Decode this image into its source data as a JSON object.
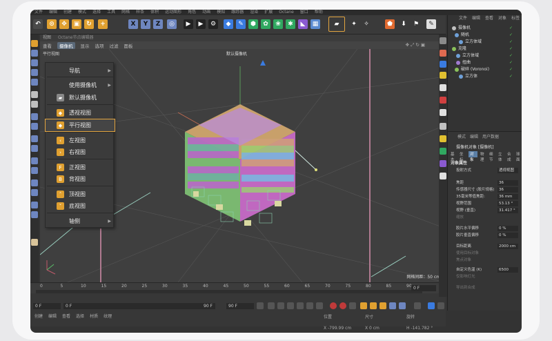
{
  "menubar": [
    "文件",
    "编辑",
    "创建",
    "模式",
    "选择",
    "工具",
    "网格",
    "样条",
    "体积",
    "运动图形",
    "角色",
    "动画",
    "模拟",
    "跟踪器",
    "渲染",
    "扩展",
    "Octane",
    "窗口",
    "帮助"
  ],
  "viewport_header": {
    "title": "视图",
    "hint": "Octane节点编辑器"
  },
  "viewport_menu": {
    "items": [
      "查看",
      "摄像机",
      "显示",
      "选项",
      "过滤",
      "面板"
    ],
    "active": "摄像机"
  },
  "viewport": {
    "mode_label": "平行视图",
    "camera_label": "默认摄像机",
    "grid_label": "网格间距：50 cm"
  },
  "camera_menu": {
    "items": [
      {
        "label": "导航",
        "icon": "",
        "submenu": true
      },
      {
        "label": "使用摄像机",
        "icon": "",
        "submenu": true
      },
      {
        "label": "默认摄像机",
        "icon": "camera-icon",
        "submenu": false
      },
      {
        "label": "透视视图",
        "icon": "perspective-cube-icon",
        "submenu": false
      },
      {
        "label": "平行视图",
        "icon": "parallel-cube-icon",
        "submenu": false
      },
      {
        "label": "左视图",
        "icon": "left-arrow-icon",
        "submenu": false
      },
      {
        "label": "右视图",
        "icon": "right-arrow-icon",
        "submenu": false
      },
      {
        "label": "正视图",
        "icon": "front-f-icon",
        "submenu": false
      },
      {
        "label": "背视图",
        "icon": "back-b-icon",
        "submenu": false
      },
      {
        "label": "顶视图",
        "icon": "top-arrow-icon",
        "submenu": false
      },
      {
        "label": "底视图",
        "icon": "bottom-arrow-icon",
        "submenu": false
      },
      {
        "label": "轴侧",
        "icon": "",
        "submenu": true
      }
    ],
    "highlighted": "平行视图"
  },
  "timeline": {
    "ticks": [
      "0",
      "5",
      "10",
      "15",
      "20",
      "25",
      "30",
      "35",
      "40",
      "45",
      "50",
      "55",
      "60",
      "65",
      "70",
      "75",
      "80",
      "85",
      "90"
    ],
    "current_frame": "0 F"
  },
  "playback": {
    "start": "0 F",
    "range_start": "0 F",
    "range_end": "90 F",
    "end": "90 F"
  },
  "bottom_menu": [
    "创建",
    "编辑",
    "查看",
    "选择",
    "材质",
    "纹理"
  ],
  "coords": {
    "position_label": "位置",
    "size_label": "尺寸",
    "rotation_label": "旋转",
    "x_pos": "X  -799.99 cm",
    "x_size": "X  0 cm",
    "h_rot": "H  -141.782 °"
  },
  "object_panel": {
    "menu": [
      "文件",
      "编辑",
      "查看",
      "对象",
      "标签"
    ],
    "rows": [
      {
        "label": "摄像机",
        "color": "#d0d0d0",
        "dot": "#c0c0c0"
      },
      {
        "label": "随机",
        "color": "#d0d0d0",
        "dot": "#6fa0d8"
      },
      {
        "label": "立方体域",
        "color": "#d0d0d0",
        "dot": "#6fa0d8"
      },
      {
        "label": "克隆",
        "color": "#d0d0d0",
        "dot": "#8ac05a"
      },
      {
        "label": "立方体域",
        "color": "#d0d0d0",
        "dot": "#6fa0d8"
      },
      {
        "label": "扭曲",
        "color": "#d0d0d0",
        "dot": "#a07ad0"
      },
      {
        "label": "破碎 (Voronoi)",
        "color": "#d0d0d0",
        "dot": "#8ac05a"
      },
      {
        "label": "立方体",
        "color": "#d0d0d0",
        "dot": "#6fa0d8"
      }
    ]
  },
  "attributes": {
    "menu": [
      "模式",
      "编辑",
      "用户数据"
    ],
    "title": "摄像机对象 [摄像机]",
    "tabs": [
      "基本",
      "坐标",
      "对象",
      "物理",
      "细节",
      "立体",
      "合成",
      "球面"
    ],
    "active_tab": "对象",
    "section": "对象属性",
    "rows": [
      {
        "label": "投射方式",
        "value": "透视视图"
      },
      {
        "label": "焦距",
        "value": "36"
      },
      {
        "label": "传感器尺寸 (胶片规格)",
        "value": "36"
      },
      {
        "label": "35毫米等值焦距:",
        "value": "36 mm"
      },
      {
        "label": "视野范围",
        "value": "53.13 °"
      },
      {
        "label": "视野 (垂直)",
        "value": "31.417 °"
      },
      {
        "label": "缩放",
        "value": ""
      },
      {
        "label": "胶片水平偏移",
        "value": "0 %"
      },
      {
        "label": "胶片垂直偏移",
        "value": "0 %"
      },
      {
        "label": "目标距离",
        "value": "2000 cm"
      },
      {
        "label": "使用目标对象",
        "value": ""
      },
      {
        "label": "焦点对象",
        "value": ""
      },
      {
        "label": "自定义色温 (K)",
        "value": "6500"
      },
      {
        "label": "仅影响灯光",
        "value": ""
      },
      {
        "label": "导出到合成",
        "value": ""
      }
    ]
  }
}
